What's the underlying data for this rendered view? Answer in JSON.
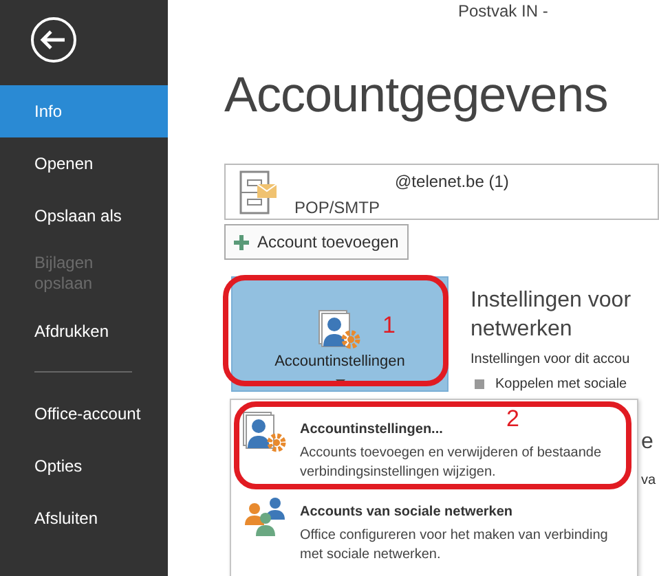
{
  "sidebar": {
    "items": [
      {
        "label": "Info",
        "selected": true,
        "disabled": false,
        "divider_before": false
      },
      {
        "label": "Openen",
        "selected": false,
        "disabled": false,
        "divider_before": false
      },
      {
        "label": "Opslaan als",
        "selected": false,
        "disabled": false,
        "divider_before": false
      },
      {
        "label": "Bijlagen opslaan",
        "selected": false,
        "disabled": true,
        "divider_before": false
      },
      {
        "label": "Afdrukken",
        "selected": false,
        "disabled": false,
        "divider_before": false
      },
      {
        "label": "Office-account",
        "selected": false,
        "disabled": false,
        "divider_before": true
      },
      {
        "label": "Opties",
        "selected": false,
        "disabled": false,
        "divider_before": false
      },
      {
        "label": "Afsluiten",
        "selected": false,
        "disabled": false,
        "divider_before": false
      }
    ]
  },
  "window": {
    "title": "Postvak IN -"
  },
  "page_title": "Accountgegevens",
  "account": {
    "address": "@telenet.be (1)",
    "type": "POP/SMTP"
  },
  "add_account_button": "Account toevoegen",
  "settings_button": {
    "label": "Accountinstellingen",
    "expanded": true
  },
  "section": {
    "heading_lines": [
      "Instellingen voor",
      "netwerken"
    ],
    "text": "Instellingen voor dit accou",
    "bullet": "Koppelen met sociale",
    "next_heading": "e",
    "next_text": "va"
  },
  "menu": [
    {
      "title": "Accountinstellingen...",
      "description": "Accounts toevoegen en verwijderen of bestaande verbindingsinstellingen wijzigen.",
      "kind": "settings"
    },
    {
      "title": "Accounts van sociale netwerken",
      "description": "Office configureren voor het maken van verbinding met sociale netwerken.",
      "kind": "social"
    }
  ],
  "annotations": [
    {
      "label": "1"
    },
    {
      "label": "2"
    }
  ]
}
